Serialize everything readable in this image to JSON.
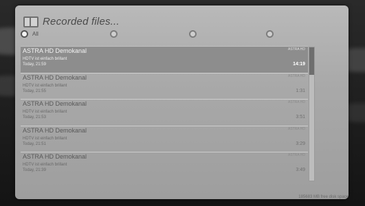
{
  "header": {
    "title": "Recorded files...",
    "folder_icon": "folder-icon"
  },
  "filters": [
    {
      "label": "All",
      "selected": true
    },
    {
      "label": "",
      "selected": false
    },
    {
      "label": "",
      "selected": false
    },
    {
      "label": "",
      "selected": false
    }
  ],
  "recordings": [
    {
      "name": "ASTRA HD Demokanal",
      "description": "HDTV ist einfach brillant",
      "when": "Today, 21:59",
      "channel": "ASTRA HD",
      "duration": "14:19",
      "selected": true
    },
    {
      "name": "ASTRA HD Demokanal",
      "description": "HDTV ist einfach brillant",
      "when": "Today, 21:55",
      "channel": "ASTRA HD",
      "duration": "1:31",
      "selected": false
    },
    {
      "name": "ASTRA HD Demokanal",
      "description": "HDTV ist einfach brillant",
      "when": "Today, 21:53",
      "channel": "ASTRA HD",
      "duration": "3:51",
      "selected": false
    },
    {
      "name": "ASTRA HD Demokanal",
      "description": "HDTV ist einfach brillant",
      "when": "Today, 21:51",
      "channel": "ASTRA HD",
      "duration": "3:29",
      "selected": false
    },
    {
      "name": "ASTRA HD Demokanal",
      "description": "HDTV ist einfach brillant",
      "when": "Today, 21:39",
      "channel": "ASTRA HD",
      "duration": "3:49",
      "selected": false
    }
  ],
  "footer": {
    "free_space": "185683 MB free disk space"
  },
  "colors": {
    "panel": "#b0b0b0",
    "selected_row": "#8d8d8d",
    "scroll_thumb": "#6e6e6e"
  }
}
